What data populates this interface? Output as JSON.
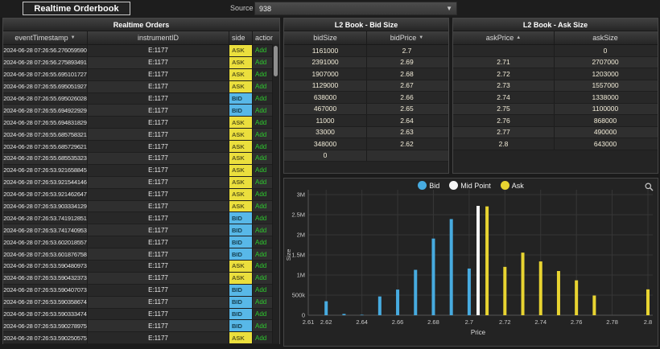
{
  "topbar": {
    "title": "Realtime Orderbook",
    "source_label": "Source",
    "source_value": "938"
  },
  "orders": {
    "title": "Realtime Orders",
    "columns": [
      {
        "label": "eventTimestamp",
        "sort": "▼"
      },
      {
        "label": "instrumentID",
        "sort": ""
      },
      {
        "label": "side",
        "sort": ""
      },
      {
        "label": "action",
        "sort": ""
      }
    ],
    "rows": [
      {
        "ts": "2024-06-28 07:26:56.276059590",
        "instrument": "E:1177",
        "side": "ASK",
        "action": "Add"
      },
      {
        "ts": "2024-06-28 07:26:56.275893491",
        "instrument": "E:1177",
        "side": "ASK",
        "action": "Add"
      },
      {
        "ts": "2024-06-28 07:26:55.695101727",
        "instrument": "E:1177",
        "side": "ASK",
        "action": "Add"
      },
      {
        "ts": "2024-06-28 07:26:55.695051927",
        "instrument": "E:1177",
        "side": "ASK",
        "action": "Add"
      },
      {
        "ts": "2024-06-28 07:26:55.695026028",
        "instrument": "E:1177",
        "side": "BID",
        "action": "Add"
      },
      {
        "ts": "2024-06-28 07:26:55.694922929",
        "instrument": "E:1177",
        "side": "BID",
        "action": "Add"
      },
      {
        "ts": "2024-06-28 07:26:55.694831829",
        "instrument": "E:1177",
        "side": "ASK",
        "action": "Add"
      },
      {
        "ts": "2024-06-28 07:26:55.685758321",
        "instrument": "E:1177",
        "side": "ASK",
        "action": "Add"
      },
      {
        "ts": "2024-06-28 07:26:55.685729621",
        "instrument": "E:1177",
        "side": "ASK",
        "action": "Add"
      },
      {
        "ts": "2024-06-28 07:26:55.685535323",
        "instrument": "E:1177",
        "side": "ASK",
        "action": "Add"
      },
      {
        "ts": "2024-06-28 07:26:53.921658845",
        "instrument": "E:1177",
        "side": "ASK",
        "action": "Add"
      },
      {
        "ts": "2024-06-28 07:26:53.921544146",
        "instrument": "E:1177",
        "side": "ASK",
        "action": "Add"
      },
      {
        "ts": "2024-06-28 07:26:53.921462647",
        "instrument": "E:1177",
        "side": "ASK",
        "action": "Add"
      },
      {
        "ts": "2024-06-28 07:26:53.903334129",
        "instrument": "E:1177",
        "side": "ASK",
        "action": "Add"
      },
      {
        "ts": "2024-06-28 07:26:53.741912851",
        "instrument": "E:1177",
        "side": "BID",
        "action": "Add"
      },
      {
        "ts": "2024-06-28 07:26:53.741740953",
        "instrument": "E:1177",
        "side": "BID",
        "action": "Add"
      },
      {
        "ts": "2024-06-28 07:26:53.602018557",
        "instrument": "E:1177",
        "side": "BID",
        "action": "Add"
      },
      {
        "ts": "2024-06-28 07:26:53.601876758",
        "instrument": "E:1177",
        "side": "BID",
        "action": "Add"
      },
      {
        "ts": "2024-06-28 07:26:53.590480973",
        "instrument": "E:1177",
        "side": "ASK",
        "action": "Add"
      },
      {
        "ts": "2024-06-28 07:26:53.590432373",
        "instrument": "E:1177",
        "side": "ASK",
        "action": "Add"
      },
      {
        "ts": "2024-06-28 07:26:53.590407073",
        "instrument": "E:1177",
        "side": "BID",
        "action": "Add"
      },
      {
        "ts": "2024-06-28 07:26:53.590358674",
        "instrument": "E:1177",
        "side": "BID",
        "action": "Add"
      },
      {
        "ts": "2024-06-28 07:26:53.590333474",
        "instrument": "E:1177",
        "side": "BID",
        "action": "Add"
      },
      {
        "ts": "2024-06-28 07:26:53.590278975",
        "instrument": "E:1177",
        "side": "BID",
        "action": "Add"
      },
      {
        "ts": "2024-06-28 07:26:53.590250575",
        "instrument": "E:1177",
        "side": "ASK",
        "action": "Add"
      }
    ]
  },
  "bid_book": {
    "title": "L2 Book - Bid Size",
    "columns": [
      {
        "label": "bidSize",
        "sort": ""
      },
      {
        "label": "bidPrice",
        "sort": "▼"
      }
    ],
    "rows": [
      [
        "1161000",
        "2.7"
      ],
      [
        "2391000",
        "2.69"
      ],
      [
        "1907000",
        "2.68"
      ],
      [
        "1129000",
        "2.67"
      ],
      [
        "638000",
        "2.66"
      ],
      [
        "467000",
        "2.65"
      ],
      [
        "11000",
        "2.64"
      ],
      [
        "33000",
        "2.63"
      ],
      [
        "348000",
        "2.62"
      ],
      [
        "0",
        ""
      ]
    ]
  },
  "ask_book": {
    "title": "L2 Book - Ask Size",
    "columns": [
      {
        "label": "askPrice",
        "sort": "▲"
      },
      {
        "label": "askSize",
        "sort": ""
      }
    ],
    "rows": [
      [
        "",
        "0"
      ],
      [
        "2.71",
        "2707000"
      ],
      [
        "2.72",
        "1203000"
      ],
      [
        "2.73",
        "1557000"
      ],
      [
        "2.74",
        "1338000"
      ],
      [
        "2.75",
        "1100000"
      ],
      [
        "2.76",
        "868000"
      ],
      [
        "2.77",
        "490000"
      ],
      [
        "2.8",
        "643000"
      ]
    ]
  },
  "chart_data": {
    "type": "bar",
    "title": "",
    "xlabel": "Price",
    "ylabel": "Size",
    "xlim": [
      2.61,
      2.8
    ],
    "ylim": [
      0,
      3000000
    ],
    "grid": true,
    "legend_position": "top-center",
    "x_ticks": [
      {
        "v": 2.61,
        "l": "2.61"
      },
      {
        "v": 2.62,
        "l": "2.62"
      },
      {
        "v": 2.64,
        "l": "2.64"
      },
      {
        "v": 2.66,
        "l": "2.66"
      },
      {
        "v": 2.68,
        "l": "2.68"
      },
      {
        "v": 2.7,
        "l": "2.7"
      },
      {
        "v": 2.72,
        "l": "2.72"
      },
      {
        "v": 2.74,
        "l": "2.74"
      },
      {
        "v": 2.76,
        "l": "2.76"
      },
      {
        "v": 2.78,
        "l": "2.78"
      },
      {
        "v": 2.8,
        "l": "2.8"
      }
    ],
    "y_ticks": [
      {
        "v": 0,
        "l": "0"
      },
      {
        "v": 500000,
        "l": "500k"
      },
      {
        "v": 1000000,
        "l": "1M"
      },
      {
        "v": 1500000,
        "l": "1.5M"
      },
      {
        "v": 2000000,
        "l": "2M"
      },
      {
        "v": 2500000,
        "l": "2.5M"
      },
      {
        "v": 3000000,
        "l": "3M"
      }
    ],
    "series": [
      {
        "name": "Bid",
        "color": "#47abe0",
        "points": [
          [
            2.62,
            348000
          ],
          [
            2.63,
            33000
          ],
          [
            2.64,
            11000
          ],
          [
            2.65,
            467000
          ],
          [
            2.66,
            638000
          ],
          [
            2.67,
            1129000
          ],
          [
            2.68,
            1907000
          ],
          [
            2.69,
            2391000
          ],
          [
            2.7,
            1161000
          ]
        ]
      },
      {
        "name": "Mid Point",
        "color": "#f5f5f5",
        "points": [
          [
            2.705,
            2720000
          ]
        ]
      },
      {
        "name": "Ask",
        "color": "#e8d431",
        "points": [
          [
            2.71,
            2707000
          ],
          [
            2.72,
            1203000
          ],
          [
            2.73,
            1557000
          ],
          [
            2.74,
            1338000
          ],
          [
            2.75,
            1100000
          ],
          [
            2.76,
            868000
          ],
          [
            2.77,
            490000
          ],
          [
            2.8,
            643000
          ]
        ]
      }
    ]
  },
  "colors": {
    "ask_badge": "#ebdf3d",
    "bid_badge": "#58b8e8",
    "action_green": "#2fca2f",
    "bid_series": "#47abe0",
    "mid_series": "#f5f5f5",
    "ask_series": "#e8d431"
  }
}
